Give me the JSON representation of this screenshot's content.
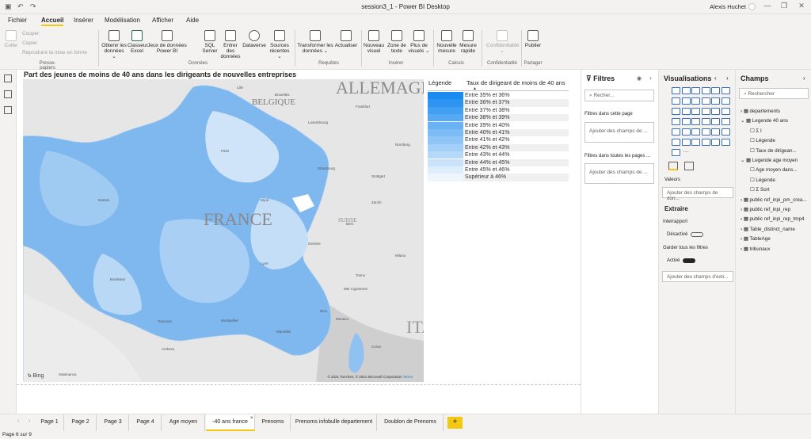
{
  "window": {
    "title": "session3_1 - Power BI Desktop",
    "user": "Alexis Huchet"
  },
  "menu": [
    "Fichier",
    "Accueil",
    "Insérer",
    "Modélisation",
    "Afficher",
    "Aide"
  ],
  "ribbon": {
    "clipboard": {
      "paste": "Coller",
      "cut": "Couper",
      "copy": "Copier",
      "format_painter": "Reproduire la mise en forme",
      "group": "Presse-papiers"
    },
    "data": {
      "get_data": "Obtenir les données ⌄",
      "excel": "Classeur Excel",
      "datasets": "Jeux de données Power BI",
      "sql": "SQL Server",
      "enter": "Entrer des données",
      "dataverse": "Dataverse",
      "recent": "Sources récentes ⌄",
      "group": "Données"
    },
    "queries": {
      "transform": "Transformer les données ⌄",
      "refresh": "Actualiser",
      "group": "Requêtes"
    },
    "insert": {
      "new_visual": "Nouveau visuel",
      "textbox": "Zone de texte",
      "more": "Plus de visuels ⌄",
      "group": "Insérer"
    },
    "calc": {
      "new_measure": "Nouvelle mesure",
      "quick_measure": "Mesure rapide",
      "group": "Calculs"
    },
    "sensitivity": {
      "label": "Confidentialité ⌄",
      "group": "Confidentialité"
    },
    "share": {
      "publish": "Publier",
      "group": "Partager"
    }
  },
  "visual": {
    "title": "Part des jeunes de moins de 40 ans dans les dirigeants de nouvelles entreprises",
    "map_labels": {
      "allemagne": "ALLEMAGN",
      "belgique": "BELGIQUE",
      "france": "FRANCE",
      "suisse": "SUISSE",
      "italie": "ITA"
    },
    "cities": [
      "Bruxelles",
      "Lille",
      "Luxembourg",
      "Frankfurt",
      "Nürnberg",
      "Paris",
      "Strasbourg",
      "Stuttgart",
      "Nantes",
      "Dijon",
      "Zürich",
      "Bern",
      "Genève",
      "Lyon",
      "Bordeaux",
      "Toulouse",
      "Marseille",
      "Montpellier",
      "Torino",
      "Milano",
      "Nice",
      "Monaco",
      "Corse",
      "Andorra",
      "Mer Ligurienne",
      "Salamanca"
    ],
    "bing": "Bing",
    "attribution": "© 2021 TomTom, © 2021 Microsoft Corporation",
    "terms": "Terms",
    "legend_header_1": "Légende",
    "legend_header_2": "Taux de dirigeant de moins de 40 ans",
    "legend": [
      {
        "label": "Entre 35% et 36%",
        "color": "#1a8cf0"
      },
      {
        "label": "Entre 36% et 37%",
        "color": "#2d95f1"
      },
      {
        "label": "Entre 37% et 38%",
        "color": "#429ff2"
      },
      {
        "label": "Entre 38% et 39%",
        "color": "#55a8f3"
      },
      {
        "label": "Entre 39% et 40%",
        "color": "#6ab2f4"
      },
      {
        "label": "Entre 40% et 41%",
        "color": "#7dbbf5"
      },
      {
        "label": "Entre 41% et 42%",
        "color": "#90c5f7"
      },
      {
        "label": "Entre 42% et 43%",
        "color": "#a4cff8"
      },
      {
        "label": "Entre 43% et 44%",
        "color": "#b7d9f9"
      },
      {
        "label": "Entre 44% et 45%",
        "color": "#cbe3fa"
      },
      {
        "label": "Entre 45% et 46%",
        "color": "#deedfc"
      },
      {
        "label": "Supérieur à 46%",
        "color": "#eef5fd"
      }
    ]
  },
  "filters": {
    "title": "Filtres",
    "search": "Recher...",
    "page_label": "Filtres dans cette page",
    "page_add": "Ajouter des champs de ...",
    "all_label": "Filtres dans toutes les pages ...",
    "all_add": "Ajouter des champs de ..."
  },
  "visualizations": {
    "title": "Visualisations",
    "values_label": "Valeurs",
    "values_add": "Ajouter des champs de don...",
    "drill_title": "Extraire",
    "cross_report": "Interrapport",
    "cross_state": "Désactivé",
    "keep_filters": "Garder tous les filtres",
    "keep_state": "Activé",
    "drill_add": "Ajouter des champs d'extr..."
  },
  "fields": {
    "title": "Champs",
    "search": "Rechercher",
    "items": [
      {
        "label": "departements",
        "level": 0,
        "kind": "table"
      },
      {
        "label": "Legende 40 ans",
        "level": 0,
        "kind": "table-open"
      },
      {
        "label": "Σ I",
        "level": 1,
        "kind": "field"
      },
      {
        "label": "Légende",
        "level": 1,
        "kind": "field"
      },
      {
        "label": "Taux de dirigean...",
        "level": 1,
        "kind": "field"
      },
      {
        "label": "Legende age moyen",
        "level": 0,
        "kind": "table-open"
      },
      {
        "label": "Age moyen dans...",
        "level": 1,
        "kind": "field"
      },
      {
        "label": "Légende",
        "level": 1,
        "kind": "field"
      },
      {
        "label": "Σ Sort",
        "level": 1,
        "kind": "field"
      },
      {
        "label": "public ref_inpi_pm_crea...",
        "level": 0,
        "kind": "table"
      },
      {
        "label": "public ref_inpi_rep",
        "level": 0,
        "kind": "table"
      },
      {
        "label": "public ref_inpi_rep_tmp4",
        "level": 0,
        "kind": "table"
      },
      {
        "label": "Table_distinct_name",
        "level": 0,
        "kind": "table"
      },
      {
        "label": "TableAge",
        "level": 0,
        "kind": "table"
      },
      {
        "label": "tribunaux",
        "level": 0,
        "kind": "table"
      }
    ]
  },
  "tabs": [
    "Page 1",
    "Page 2",
    "Page 3",
    "Page 4",
    "Age moyen",
    "-40 ans france",
    "Prenoms",
    "Prenoms infobulle departement",
    "Doublon de Prenoms"
  ],
  "active_tab": "-40 ans france",
  "status": "Page 6 sur 9"
}
